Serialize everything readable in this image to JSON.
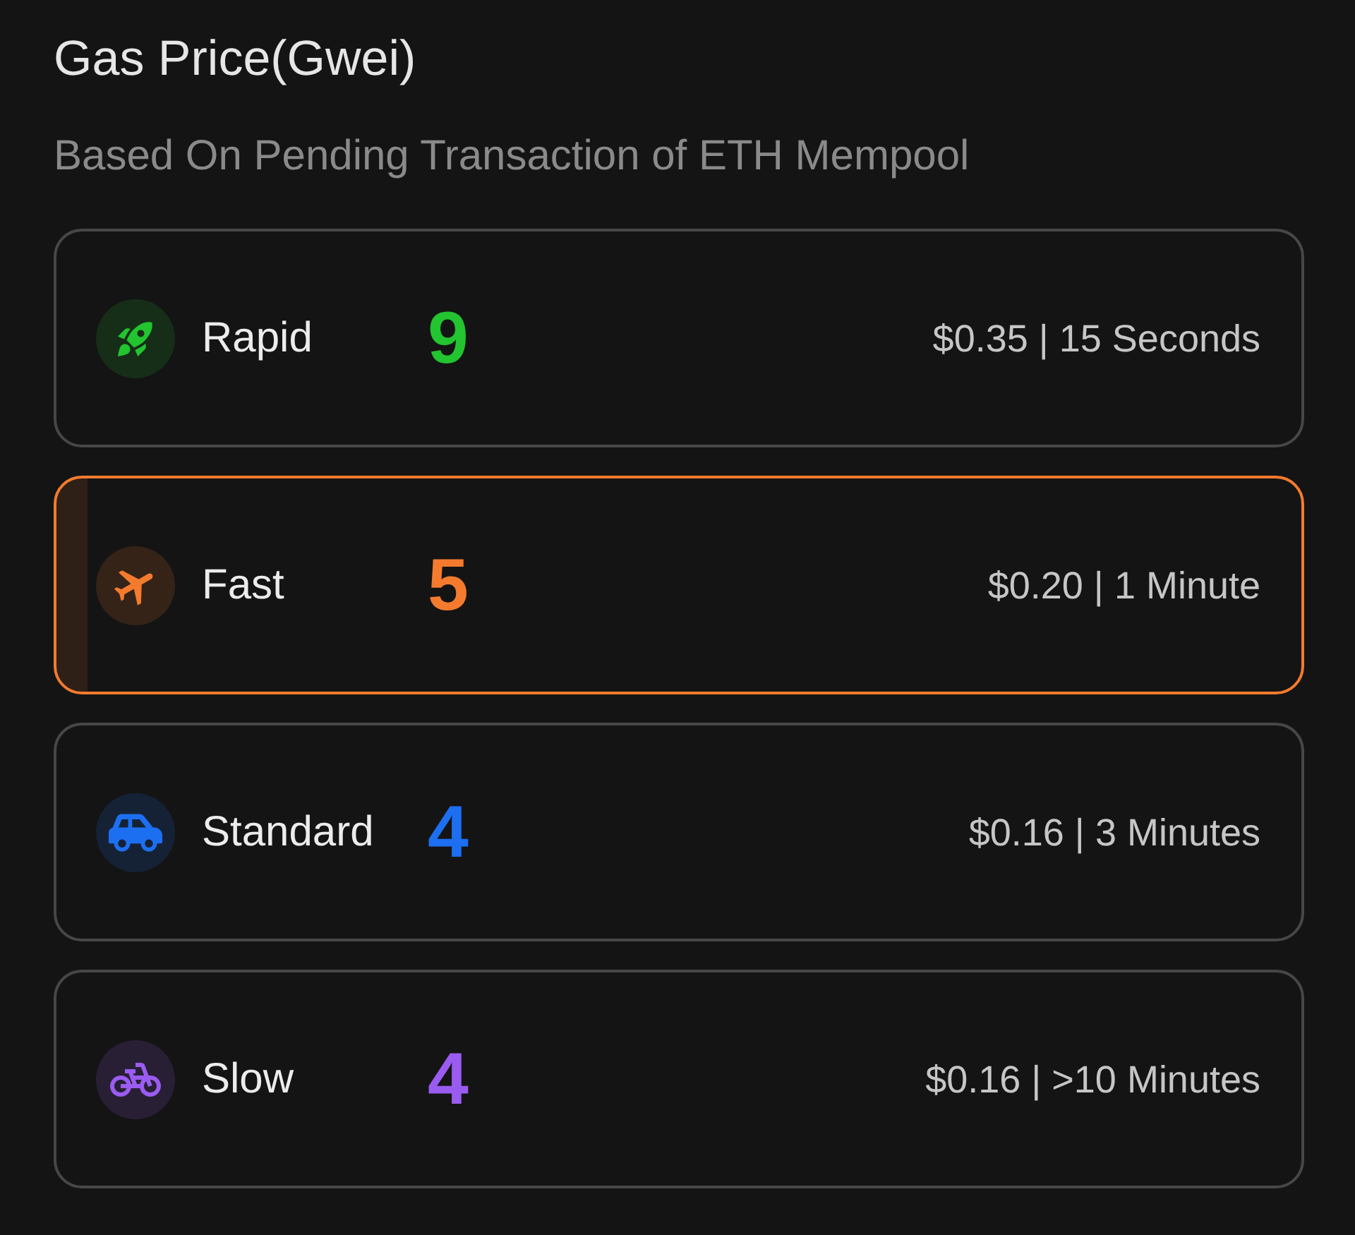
{
  "title": "Gas Price(Gwei)",
  "subtitle": "Based On Pending Transaction of ETH Mempool",
  "tiers": [
    {
      "kind": "rocket",
      "name": "Rapid",
      "gwei": "9",
      "detail": "$0.35 | 15 Seconds",
      "color": "#22c42f",
      "selected": false
    },
    {
      "kind": "plane",
      "name": "Fast",
      "gwei": "5",
      "detail": "$0.20 | 1 Minute",
      "color": "#f47b2e",
      "selected": true
    },
    {
      "kind": "car",
      "name": "Standard",
      "gwei": "4",
      "detail": "$0.16 | 3 Minutes",
      "color": "#1d6ff2",
      "selected": false
    },
    {
      "kind": "bicycle",
      "name": "Slow",
      "gwei": "4",
      "detail": "$0.16 | >10 Minutes",
      "color": "#9a5cf0",
      "selected": false
    }
  ]
}
